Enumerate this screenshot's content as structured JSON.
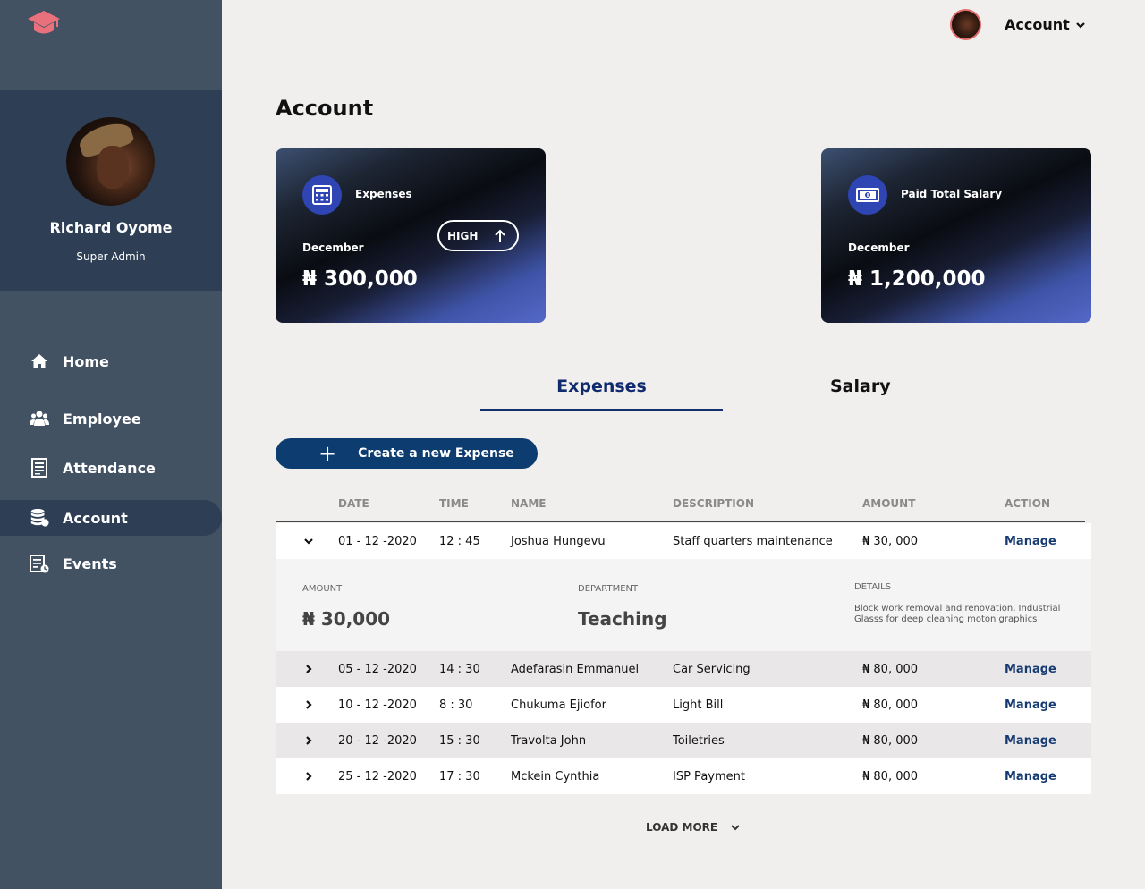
{
  "sidebar": {
    "profile": {
      "name": "Richard Oyome",
      "role": "Super Admin"
    },
    "items": [
      {
        "label": "Home",
        "icon": "home-icon"
      },
      {
        "label": "Employee",
        "icon": "users-icon"
      },
      {
        "label": "Attendance",
        "icon": "document-icon"
      },
      {
        "label": "Account",
        "icon": "coins-icon",
        "active": true
      },
      {
        "label": "Events",
        "icon": "calendar-list-icon"
      }
    ]
  },
  "header": {
    "account_label": "Account"
  },
  "page": {
    "title": "Account"
  },
  "cards": [
    {
      "label": "Expenses",
      "month": "December",
      "amount": "₦ 300,000",
      "badge": "HIGH",
      "icon": "calculator-icon"
    },
    {
      "label": "Paid Total Salary",
      "month": "December",
      "amount": "₦ 1,200,000",
      "icon": "banknote-icon"
    }
  ],
  "tabs": [
    {
      "label": "Expenses",
      "active": true
    },
    {
      "label": "Salary",
      "active": false
    }
  ],
  "create_button": {
    "label": "Create a new Expense"
  },
  "table": {
    "columns": [
      "DATE",
      "TIME",
      "NAME",
      "DESCRIPTION",
      "AMOUNT",
      "ACTION"
    ],
    "rows": [
      {
        "date": "01 - 12 -2020",
        "time": "12 : 45",
        "name": "Joshua Hungevu",
        "description": "Staff quarters maintenance",
        "amount": "₦ 30, 000",
        "action": "Manage",
        "expanded": true
      },
      {
        "date": "05 - 12 -2020",
        "time": "14 : 30",
        "name": "Adefarasin Emmanuel",
        "description": "Car Servicing",
        "amount": "₦ 80, 000",
        "action": "Manage"
      },
      {
        "date": "10 - 12 -2020",
        "time": "8 : 30",
        "name": "Chukuma Ejiofor",
        "description": "Light Bill",
        "amount": "₦ 80, 000",
        "action": "Manage"
      },
      {
        "date": "20 - 12 -2020",
        "time": "15 : 30",
        "name": "Travolta John",
        "description": "Toiletries",
        "amount": "₦ 80, 000",
        "action": "Manage"
      },
      {
        "date": "25 - 12 -2020",
        "time": "17 : 30",
        "name": "Mckein Cynthia",
        "description": "ISP Payment",
        "amount": "₦ 80, 000",
        "action": "Manage"
      }
    ],
    "detail": {
      "amount_label": "AMOUNT",
      "amount_value": "₦ 30,000",
      "department_label": "DEPARTMENT",
      "department_value": "Teaching",
      "details_label": "DETAILS",
      "details_text": "Block work removal  and renovation, Industrial Glasss for deep cleaning moton graphics"
    }
  },
  "load_more": {
    "label": "LOAD MORE"
  },
  "colors": {
    "accent": "#0d3d70",
    "brand": "#e06b6b",
    "sidebar": "#425263",
    "tab_active": "#102a6e"
  }
}
